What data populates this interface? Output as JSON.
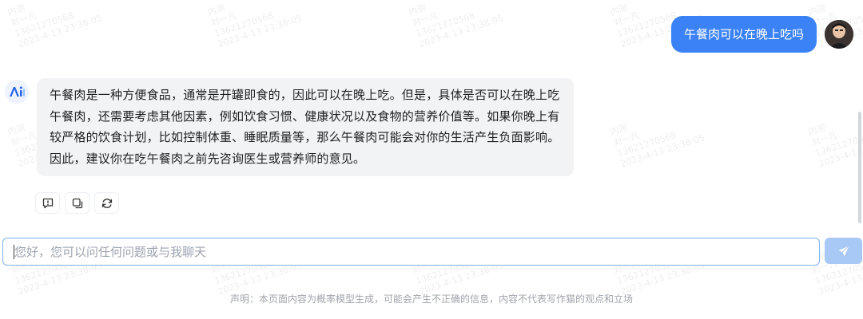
{
  "watermark": {
    "line1": "内测",
    "line2": "对一凡",
    "line3": "13621270568",
    "line4": "2023-4-13 23:38:05"
  },
  "user_message": {
    "text": "午餐肉可以在晚上吃吗"
  },
  "assistant_message": {
    "text": "午餐肉是一种方便食品，通常是开罐即食的，因此可以在晚上吃。但是，具体是否可以在晚上吃午餐肉，还需要考虑其他因素，例如饮食习惯、健康状况以及食物的营养价值等。如果你晚上有较严格的饮食计划，比如控制体重、睡眠质量等，那么午餐肉可能会对你的生活产生负面影响。因此，建议你在吃午餐肉之前先咨询医生或营养师的意见。"
  },
  "actions": {
    "feedback_icon": "feedback-icon",
    "copy_icon": "copy-icon",
    "regenerate_icon": "refresh-icon"
  },
  "input": {
    "placeholder": "您好，您可以问任何问题或与我聊天",
    "value": ""
  },
  "send_icon": "send-icon",
  "disclaimer": "声明：本页面内容为概率模型生成，可能会产生不正确的信息，内容不代表写作猫的观点和立场",
  "colors": {
    "user_bubble": "#3b82f6",
    "assistant_bubble": "#f2f3f5",
    "input_border": "#7fb0f5",
    "send_button": "#a8c9f5"
  }
}
